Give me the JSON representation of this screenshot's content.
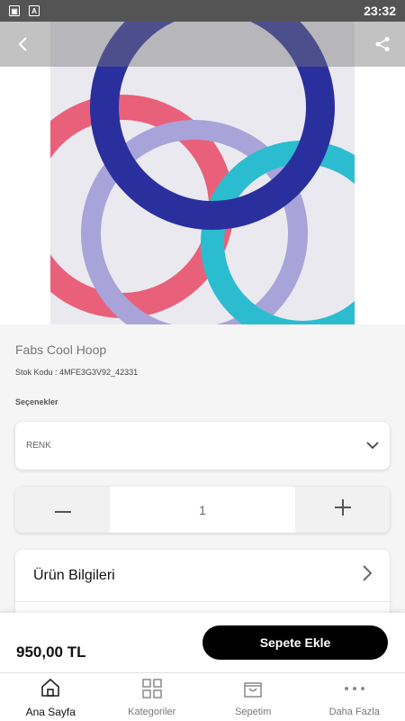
{
  "status_bar": {
    "time": "23:32",
    "icons": [
      "image-icon",
      "font-a-icon"
    ]
  },
  "product": {
    "title": "Fabs Cool Hoop",
    "sku": "Stok Kodu : 4MFE3G3V92_42331",
    "image_icon": "product-photo-rings"
  },
  "options": {
    "label": "Seçenekler",
    "select_label": "RENK"
  },
  "quantity": {
    "value": "1"
  },
  "info_section": {
    "title": "Ürün Bilgileri"
  },
  "cart": {
    "price": "950,00 TL",
    "add_label": "Sepete Ekle"
  },
  "nav": [
    {
      "label": "Ana Sayfa",
      "icon": "home-icon",
      "active": true
    },
    {
      "label": "Kategoriler",
      "icon": "grid-icon",
      "active": false
    },
    {
      "label": "Sepetim",
      "icon": "shopping-bag-icon",
      "active": false
    },
    {
      "label": "Daha Fazla",
      "icon": "more-icon",
      "active": false
    }
  ],
  "colors": {
    "accent": "#000000",
    "ring_pink": "#e9607a",
    "ring_blue": "#2a2f9e",
    "ring_lavender": "#a8a3d8",
    "ring_cyan": "#2bbcd0"
  }
}
